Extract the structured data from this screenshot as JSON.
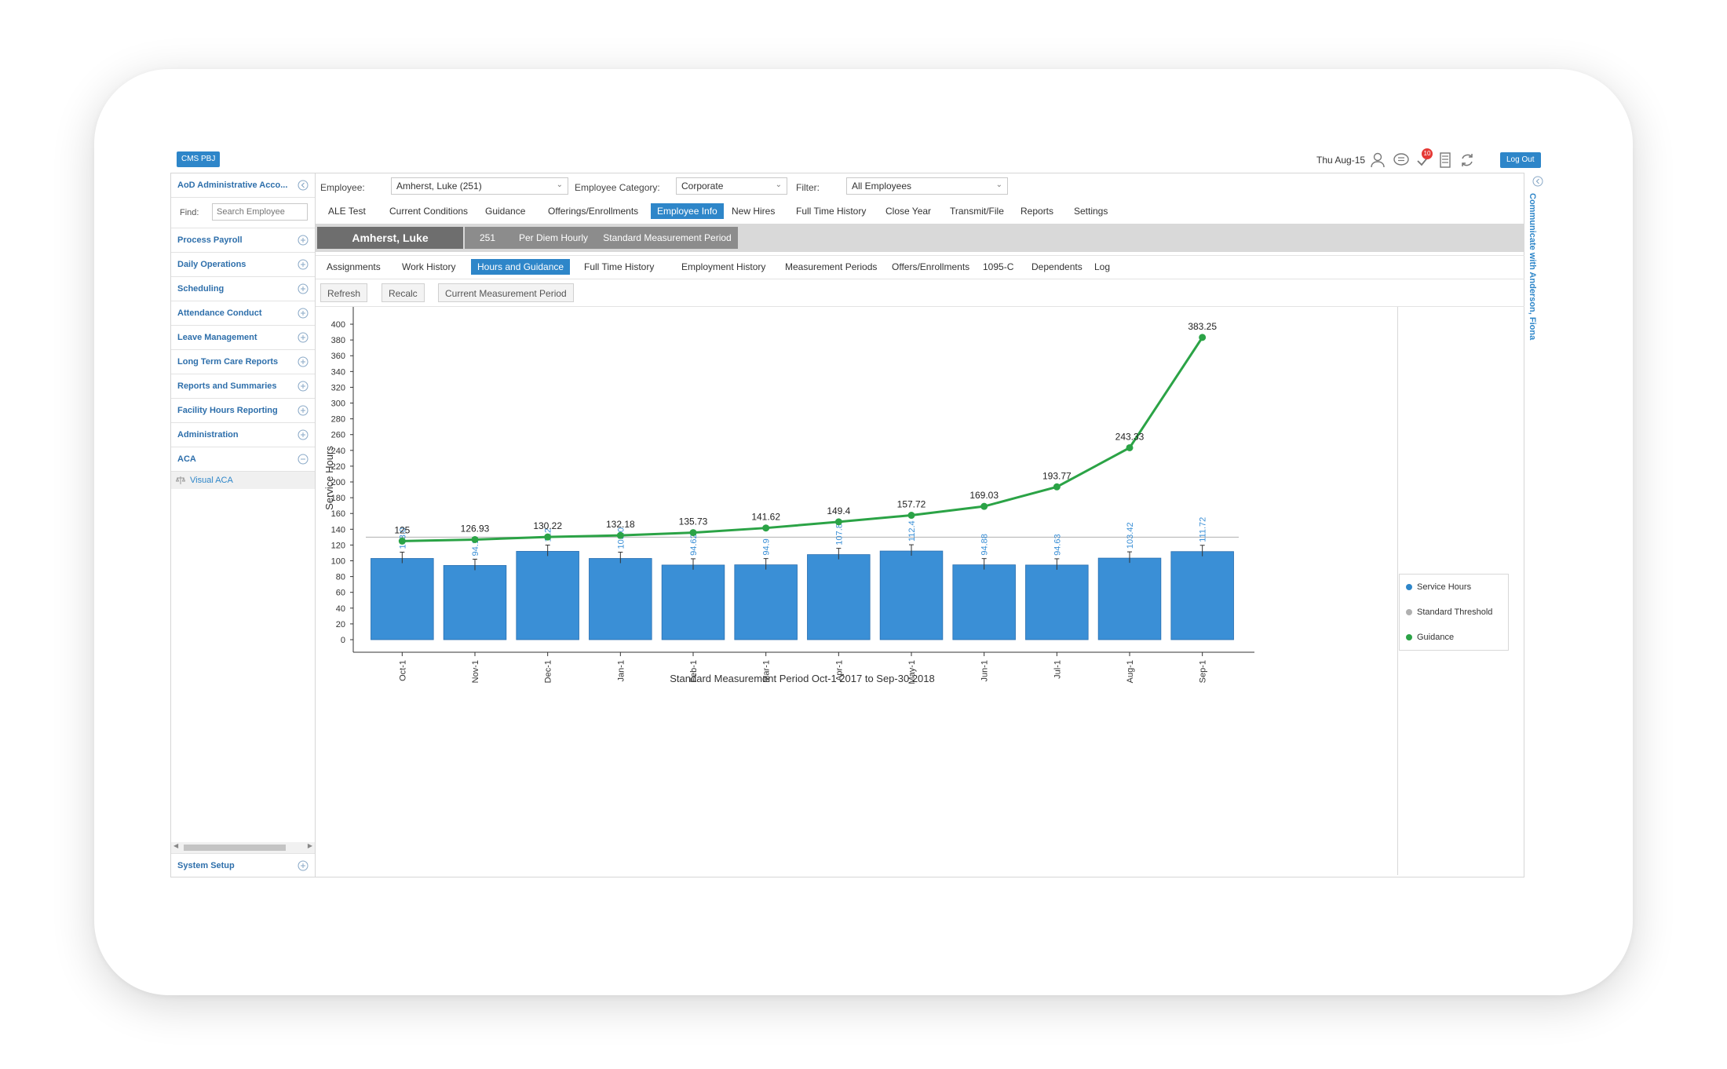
{
  "header": {
    "app_button": "CMS PBJ",
    "date": "Thu Aug-15",
    "notification_count": "10",
    "logout": "Log Out"
  },
  "sidebar": {
    "account": "AoD Administrative Acco...",
    "find_label": "Find:",
    "search_placeholder": "Search Employee",
    "items": [
      {
        "label": "Process Payroll"
      },
      {
        "label": "Daily Operations"
      },
      {
        "label": "Scheduling"
      },
      {
        "label": "Attendance Conduct"
      },
      {
        "label": "Leave Management"
      },
      {
        "label": "Long Term Care Reports"
      },
      {
        "label": "Reports and Summaries"
      },
      {
        "label": "Facility Hours Reporting"
      },
      {
        "label": "Administration"
      },
      {
        "label": "ACA"
      }
    ],
    "sub_item": "Visual ACA",
    "system_setup": "System Setup"
  },
  "filters": {
    "employee_label": "Employee:",
    "employee_value": "Amherst, Luke  (251)",
    "category_label": "Employee Category:",
    "category_value": "Corporate",
    "filter_label": "Filter:",
    "filter_value": "All Employees"
  },
  "main_tabs": [
    "ALE Test",
    "Current Conditions",
    "Guidance",
    "Offerings/Enrollments",
    "Employee Info",
    "New Hires",
    "Full Time History",
    "Close Year",
    "Transmit/File",
    "Reports",
    "Settings"
  ],
  "employee_bar": {
    "name": "Amherst, Luke",
    "id": "251",
    "type": "Per Diem Hourly",
    "period": "Standard Measurement Period"
  },
  "sub_tabs": [
    "Assignments",
    "Work History",
    "Hours and Guidance",
    "Full Time History",
    "Employment History",
    "Measurement Periods",
    "Offers/Enrollments",
    "1095-C",
    "Dependents",
    "Log"
  ],
  "buttons": {
    "refresh": "Refresh",
    "recalc": "Recalc",
    "current_period": "Current Measurement Period"
  },
  "right_panel": {
    "communicate": "Communicate with Anderson, Fiona"
  },
  "colors": {
    "accent": "#2e86c9",
    "bar": "#3a8fd6",
    "guidance": "#2ba346",
    "threshold": "#b0b0b0"
  },
  "chart_data": {
    "type": "bar",
    "categories": [
      "Oct-1",
      "Nov-1",
      "Dec-1",
      "Jan-1",
      "Feb-1",
      "Mar-1",
      "Apr-1",
      "May-1",
      "Jun-1",
      "Jul-1",
      "Aug-1",
      "Sep-1"
    ],
    "series": [
      {
        "name": "Service Hours",
        "type": "bar",
        "values": [
          103.0,
          94.1,
          112.0,
          103.0,
          94.62,
          94.9,
          107.88,
          112.4,
          94.88,
          94.63,
          103.42,
          111.72
        ]
      },
      {
        "name": "Standard Threshold",
        "type": "line",
        "values": [
          130,
          130,
          130,
          130,
          130,
          130,
          130,
          130,
          130,
          130,
          130,
          130
        ]
      },
      {
        "name": "Guidance",
        "type": "line",
        "values": [
          125,
          126.93,
          130.22,
          132.18,
          135.73,
          141.62,
          149.4,
          157.72,
          169.03,
          193.77,
          243.33,
          383.25
        ]
      }
    ],
    "bar_labels": [
      "103.0",
      "94.1",
      "112",
      "103.0",
      "94.62",
      "94.9",
      "107.88",
      "112.4",
      "94.88",
      "94.63",
      "103.42",
      "111.72"
    ],
    "guidance_labels": [
      "125",
      "126.93",
      "130.22",
      "132.18",
      "135.73",
      "141.62",
      "149.4",
      "157.72",
      "169.03",
      "193.77",
      "243.33",
      "383.25"
    ],
    "ylabel": "Service Hours",
    "xlabel": "Standard Measurement Period Oct-1 2017 to Sep-30 2018",
    "ylim": [
      0,
      410
    ],
    "yticks": [
      0,
      20,
      40,
      60,
      80,
      100,
      120,
      140,
      160,
      180,
      200,
      220,
      240,
      260,
      280,
      300,
      320,
      340,
      360,
      380,
      400
    ],
    "legend_position": "right"
  }
}
